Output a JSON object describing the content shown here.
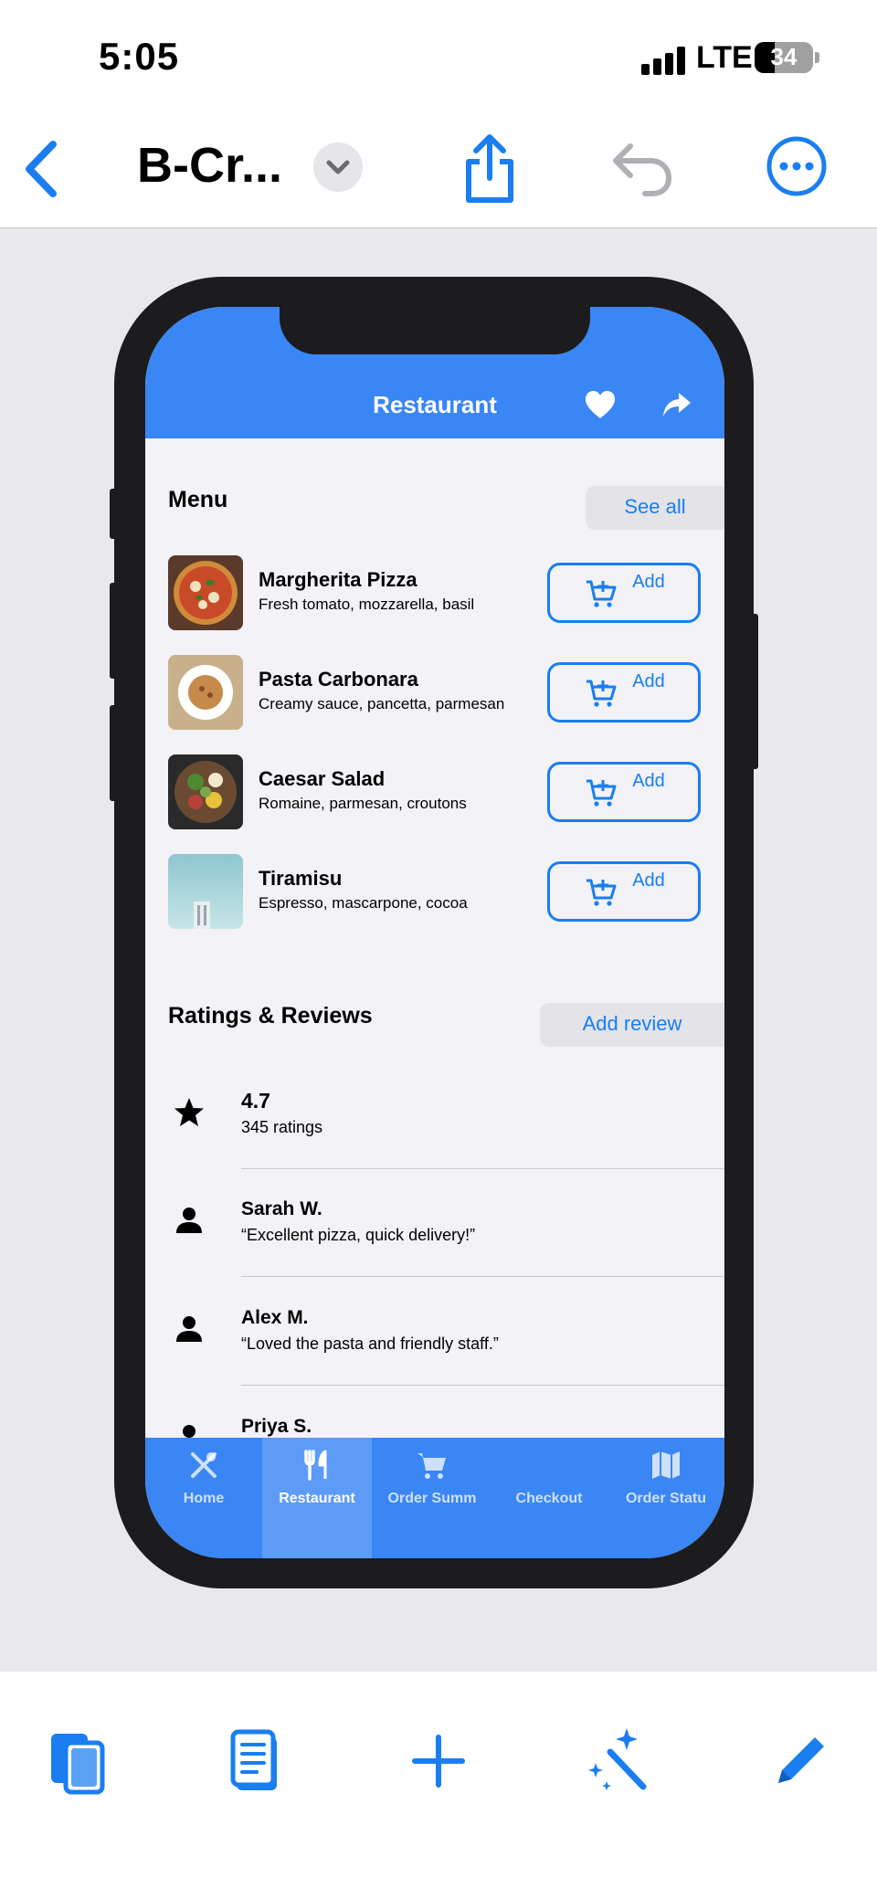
{
  "status_bar": {
    "time": "5:05",
    "network": "LTE",
    "battery": "34"
  },
  "toolbar": {
    "title": "B-Cr..."
  },
  "app": {
    "header_title": "Restaurant",
    "menu": {
      "title": "Menu",
      "see_all": "See all",
      "add_label": "Add",
      "items": [
        {
          "name": "Margherita Pizza",
          "desc": "Fresh tomato, mozzarella, basil"
        },
        {
          "name": "Pasta Carbonara",
          "desc": "Creamy sauce, pancetta, parmesan"
        },
        {
          "name": "Caesar Salad",
          "desc": "Romaine, parmesan, croutons"
        },
        {
          "name": "Tiramisu",
          "desc": "Espresso, mascarpone, cocoa"
        }
      ]
    },
    "ratings": {
      "title": "Ratings & Reviews",
      "add_review": "Add review",
      "summary": {
        "value": "4.7",
        "count": "345 ratings"
      },
      "reviews": [
        {
          "name": "Sarah W.",
          "text": "“Excellent pizza, quick delivery!”"
        },
        {
          "name": "Alex M.",
          "text": "“Loved the pasta and friendly staff.”"
        },
        {
          "name": "Priya S.",
          "text": ""
        }
      ]
    },
    "tabs": [
      {
        "label": "Home",
        "icon": "fork-knife-cross-icon"
      },
      {
        "label": "Restaurant",
        "icon": "fork-knife-icon",
        "active": true
      },
      {
        "label": "Order Summ",
        "icon": "cart-icon"
      },
      {
        "label": "Checkout",
        "icon": ""
      },
      {
        "label": "Order Statu",
        "icon": "map-icon"
      }
    ]
  },
  "colors": {
    "accent": "#1a7ef0",
    "app_blue": "#3a86f4",
    "canvas": "#e9e9eb"
  }
}
